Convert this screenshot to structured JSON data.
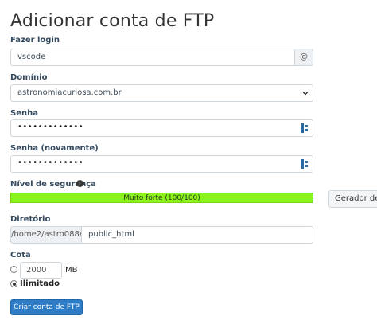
{
  "page": {
    "title": "Adicionar conta de FTP"
  },
  "form": {
    "login": {
      "label": "Fazer login",
      "value": "vscode",
      "addon": "@"
    },
    "domain": {
      "label": "Domínio",
      "value": "astronomiacuriosa.com.br"
    },
    "password": {
      "label": "Senha",
      "masked": "•••••••••••••"
    },
    "password_again": {
      "label": "Senha (novamente)",
      "masked": "•••••••••••••"
    },
    "strength": {
      "label": "Nível de segurança",
      "info_glyph": "i",
      "text": "Muito forte (100/100)",
      "level_percent": 100,
      "color": "#8af31b"
    },
    "generator_button": "Gerador de s",
    "directory": {
      "label": "Diretório",
      "prefix": "/home2/astro088/",
      "value": "public_html"
    },
    "quota": {
      "label": "Cota",
      "limited_value": "2000",
      "unit": "MB",
      "unlimited_label": "Ilimitado",
      "selected": "unlimited"
    },
    "submit_label": "Criar conta de FTP"
  },
  "colors": {
    "accent": "#2e7cc5",
    "icon": "#2d6aa3"
  },
  "icons": {
    "password_toggle": "password-key-icon",
    "dropdown": "chevron-down-icon",
    "info": "info-icon"
  }
}
